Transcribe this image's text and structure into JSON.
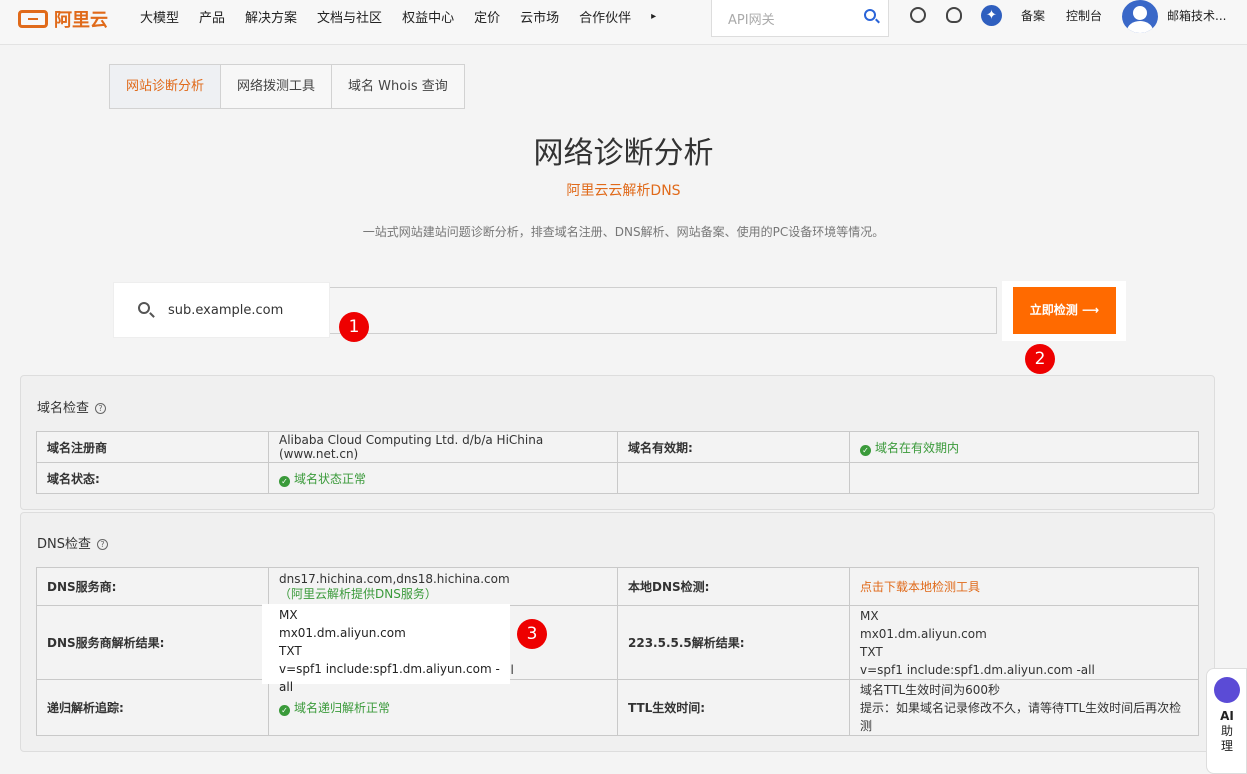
{
  "header": {
    "logo": "阿里云",
    "nav": [
      "大模型",
      "产品",
      "解决方案",
      "文档与社区",
      "权益中心",
      "定价",
      "云市场",
      "合作伙伴"
    ],
    "nav_more": "▸",
    "search_placeholder": "API网关",
    "beian": "备案",
    "console": "控制台",
    "user": "邮箱技术..."
  },
  "tabs": [
    "网站诊断分析",
    "网络拨测工具",
    "域名 Whois 查询"
  ],
  "hero": {
    "title": "网络诊断分析",
    "subtitle": "阿里云云解析DNS",
    "desc": "一站式网站建站问题诊断分析，排查域名注册、DNS解析、网站备案、使用的PC设备环境等情况。"
  },
  "search": {
    "value": "sub.example.com",
    "button": "立即检测 ⟶"
  },
  "markers": [
    "1",
    "2",
    "3"
  ],
  "domain_check": {
    "title": "域名检查",
    "registrar_label": "域名注册商",
    "registrar_value": "Alibaba Cloud Computing Ltd. d/b/a HiChina (www.net.cn)",
    "valid_label": "域名有效期:",
    "valid_value": "域名在有效期内",
    "status_label": "域名状态:",
    "status_value": "域名状态正常"
  },
  "dns_check": {
    "title": "DNS检查",
    "provider_label": "DNS服务商:",
    "provider_value": "dns17.hichina.com,dns18.hichina.com",
    "provider_note": "（阿里云解析提供DNS服务）",
    "local_label": "本地DNS检测:",
    "local_value": "点击下载本地检测工具",
    "result_label": "DNS服务商解析结果:",
    "result_lines": [
      "MX",
      "mx01.dm.aliyun.com",
      "TXT",
      "v=spf1 include:spf1.dm.aliyun.com -all"
    ],
    "public_label": "223.5.5.5解析结果:",
    "public_lines": [
      "MX",
      "mx01.dm.aliyun.com",
      "TXT",
      "v=spf1 include:spf1.dm.aliyun.com -all"
    ],
    "recursive_label": "递归解析追踪:",
    "recursive_value": "域名递归解析正常",
    "ttl_label": "TTL生效时间:",
    "ttl_lines": [
      "域名TTL生效时间为600秒",
      "提示：如果域名记录修改不久，请等待TTL生效时间后再次检",
      "测"
    ]
  },
  "ai_assistant": {
    "line1": "AI",
    "line2": "助",
    "line3": "理"
  }
}
